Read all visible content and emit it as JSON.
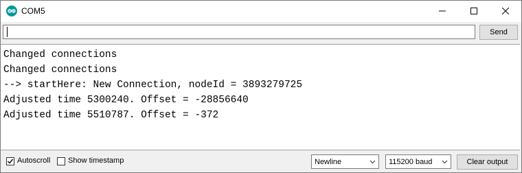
{
  "window": {
    "title": "COM5",
    "accent_color": "#00979C"
  },
  "send": {
    "input_value": "",
    "button_label": "Send"
  },
  "output": {
    "lines": [
      "Changed connections",
      "Changed connections",
      "--> startHere: New Connection, nodeId = 3893279725",
      "Adjusted time 5300240. Offset = -28856640",
      "Adjusted time 5510787. Offset = -372"
    ]
  },
  "bottom": {
    "autoscroll_label": "Autoscroll",
    "autoscroll_checked": true,
    "timestamp_label": "Show timestamp",
    "timestamp_checked": false,
    "line_ending": "Newline",
    "baud_rate": "115200 baud",
    "clear_label": "Clear output"
  },
  "icons": [
    "arduino-icon",
    "minimize-icon",
    "maximize-icon",
    "close-icon",
    "checkmark-icon",
    "chevron-down-icon"
  ]
}
